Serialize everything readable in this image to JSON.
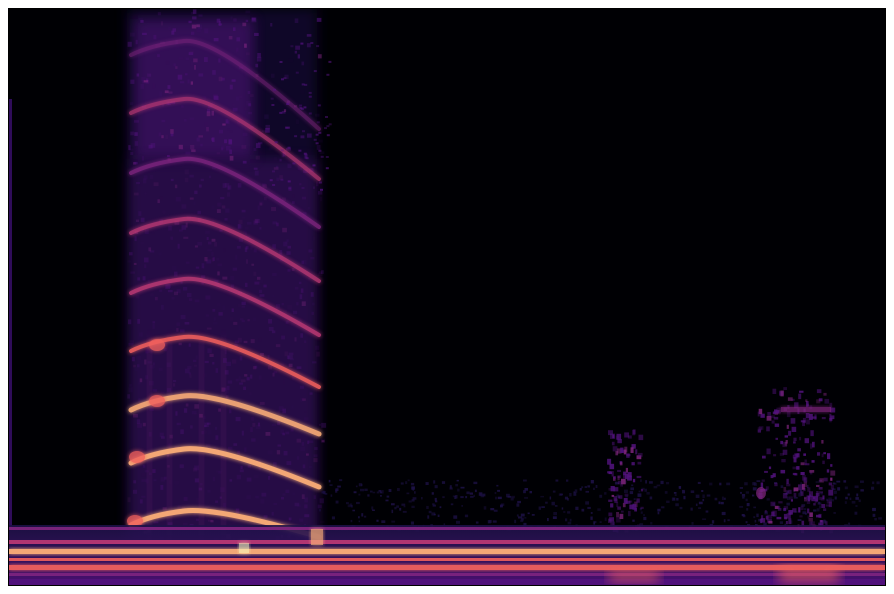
{
  "image": {
    "kind": "spectrogram",
    "colormap": "magma",
    "palette": {
      "background": "#000004",
      "dark_purple": "#1d1147",
      "purple": "#51127c",
      "magenta": "#832681",
      "pink": "#c03a76",
      "salmon": "#f1605d",
      "peach": "#feb078",
      "pale": "#fcfdbf"
    }
  }
}
